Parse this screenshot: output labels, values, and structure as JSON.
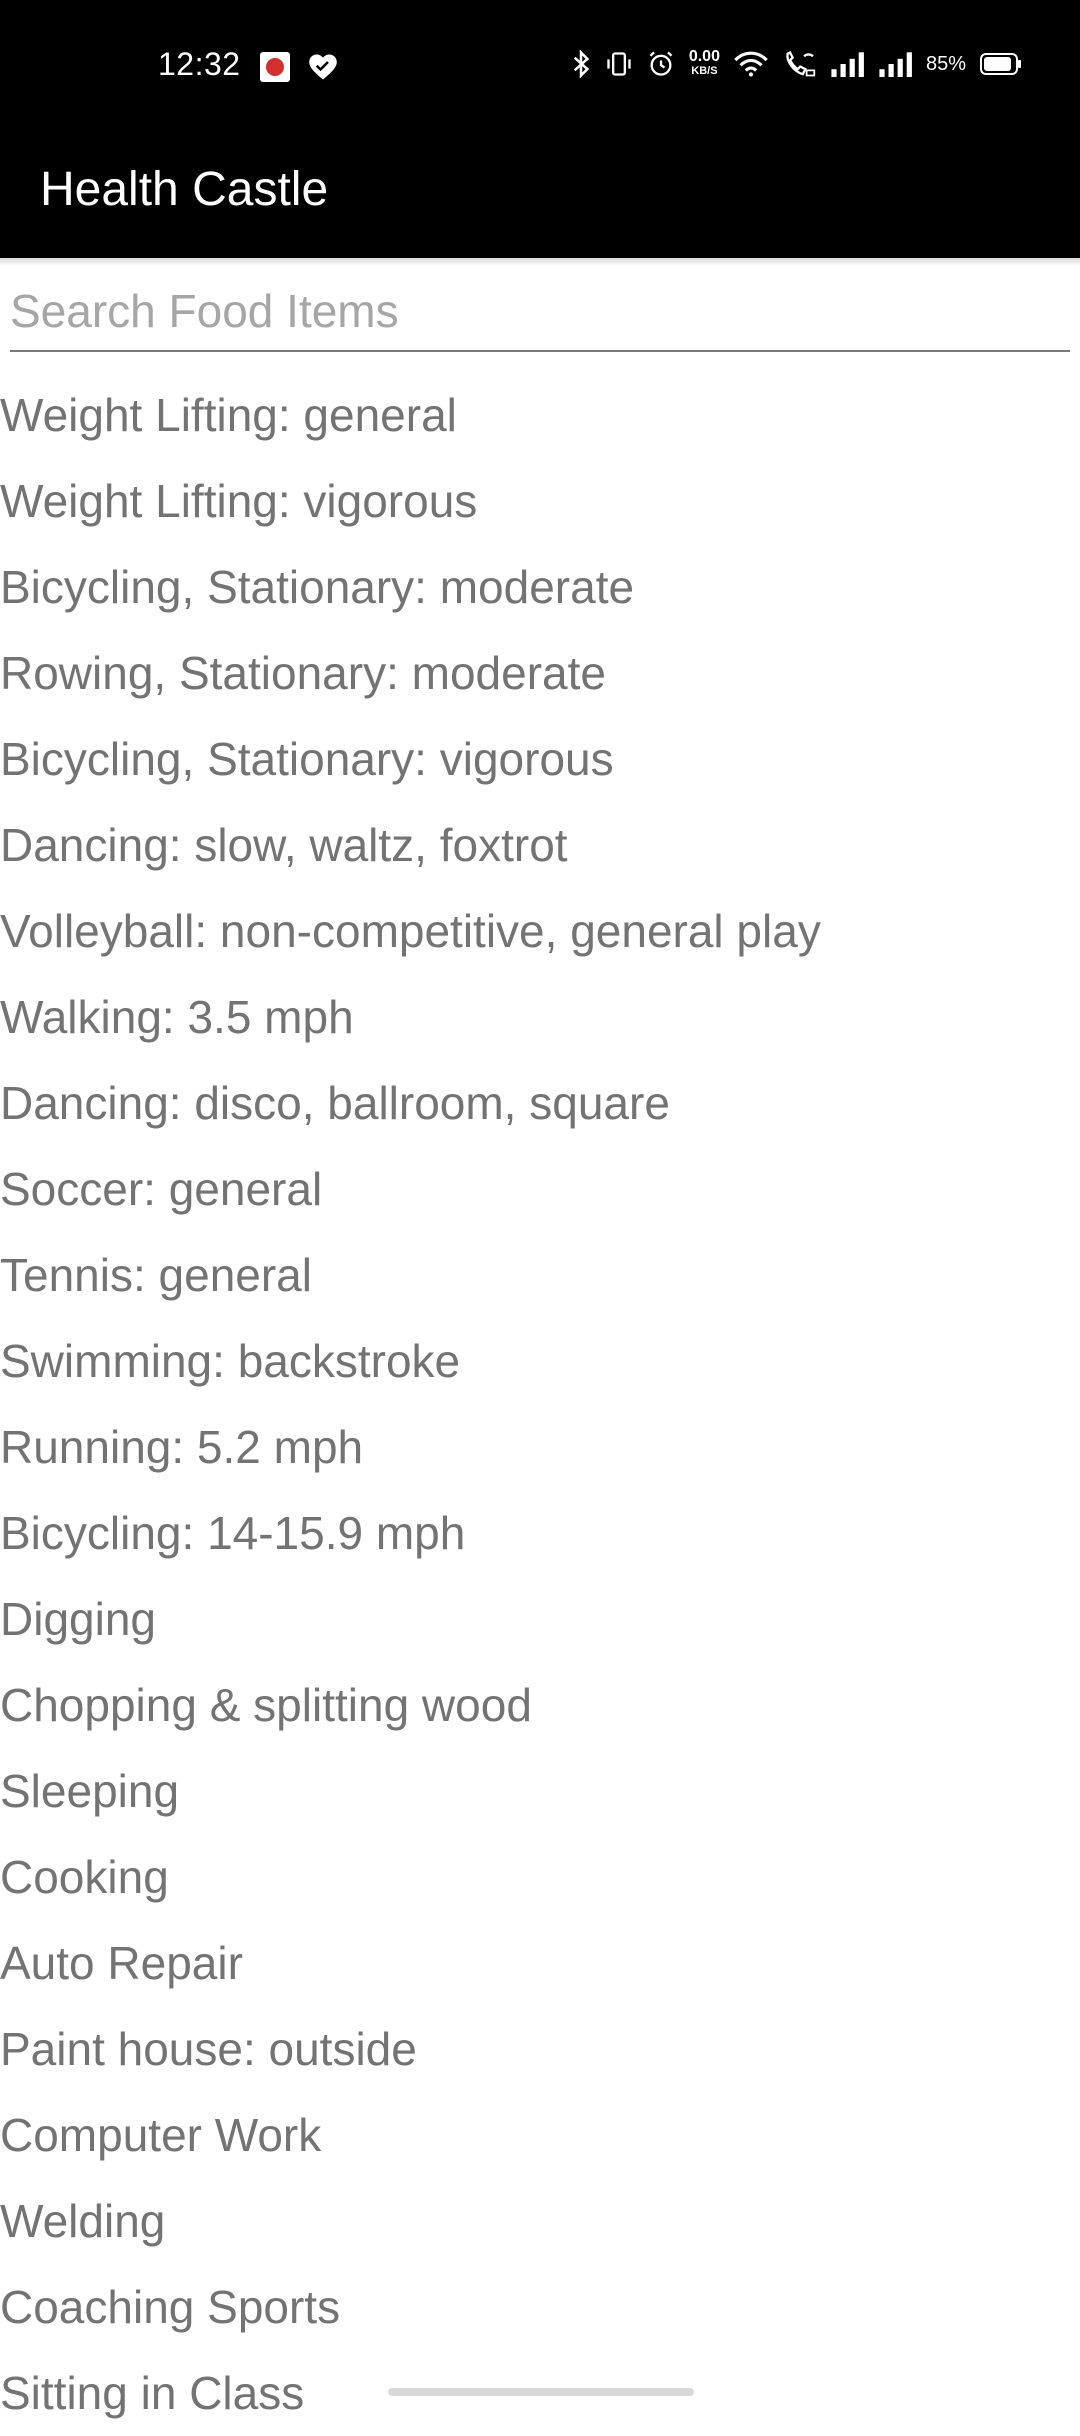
{
  "status_bar": {
    "time": "12:32",
    "left_icons": [
      "health-app-icon",
      "heart-icon"
    ],
    "right_icons": [
      "bluetooth-icon",
      "vibrate-icon",
      "alarm-icon",
      "network-speed",
      "wifi-icon",
      "wifi-calling-icon",
      "signal-icon",
      "signal-icon",
      "battery-icon"
    ],
    "network_speed_value": "0.00",
    "network_speed_unit": "KB/S",
    "battery_percent": "85%"
  },
  "app_bar": {
    "title": "Health Castle"
  },
  "search": {
    "placeholder": "Search Food Items",
    "value": ""
  },
  "activities": [
    "Weight Lifting: general",
    "Weight Lifting: vigorous",
    "Bicycling, Stationary: moderate",
    "Rowing, Stationary: moderate",
    "Bicycling, Stationary: vigorous",
    "Dancing: slow, waltz, foxtrot",
    "Volleyball: non-competitive, general play",
    "Walking: 3.5 mph",
    "Dancing: disco, ballroom, square",
    "Soccer: general",
    "Tennis: general",
    "Swimming: backstroke",
    "Running: 5.2 mph",
    "Bicycling: 14-15.9 mph",
    "Digging",
    "Chopping & splitting wood",
    "Sleeping",
    "Cooking",
    "Auto Repair",
    "Paint house: outside",
    "Computer Work",
    "Welding",
    "Coaching Sports",
    "Sitting in Class"
  ],
  "colors": {
    "app_bar_bg": "#000000",
    "list_text": "#737373",
    "placeholder": "#a6a6a6",
    "underline": "#7a7a7a"
  }
}
